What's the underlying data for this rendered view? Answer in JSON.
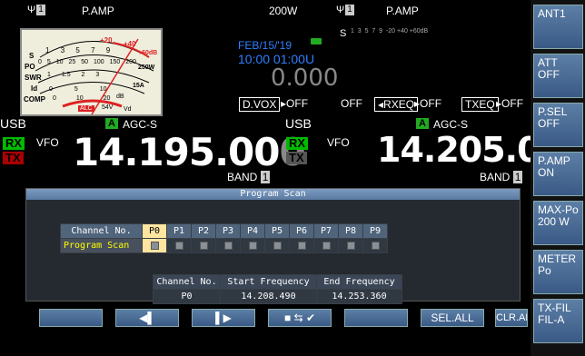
{
  "top": {
    "left_ant": "1",
    "left_mode_title": "P.AMP",
    "power": "200W",
    "right_ant": "1",
    "right_mode_title": "P.AMP",
    "date": "FEB/15/'19",
    "time": "10:00 01:00U",
    "big_value": "0.000",
    "dvox": "D.VOX",
    "dvox_state": "OFF",
    "rxeq_prefix": "OFF",
    "rxeq": "RXEQ",
    "rxeq_state": "OFF",
    "txeq": "TXEQ",
    "txeq_state": "OFF",
    "meter_scale_s": "S",
    "meter_scale_s_ticks": "1  3  5  7  9  -20 +40 +60dB"
  },
  "meter": {
    "s_label": "S",
    "po_label": "PO",
    "swr_label": "SWR",
    "id_label": "Id",
    "comp_label": "COMP",
    "alc_label": "ALC",
    "vd_label": "Vd",
    "v54_label": "54V",
    "plus20": "+20",
    "plus40": "+40",
    "plus60": "+60dB",
    "w250": "250W",
    "a15": "15A",
    "s_ticks": [
      "1",
      "3",
      "5",
      "7",
      "9"
    ],
    "po_ticks": [
      "0",
      "5",
      "10",
      "25",
      "50",
      "100",
      "150",
      "200"
    ],
    "swr_ticks": [
      "1",
      "1.5",
      "2",
      "3"
    ],
    "id_ticks": [
      "0",
      "5",
      "10"
    ],
    "comp_ticks": [
      "0",
      "10",
      "20"
    ],
    "db_label": "dB"
  },
  "vfo_a": {
    "mode": "USB",
    "agc_a": "A",
    "agc": "AGC-S",
    "rx": "RX",
    "tx": "TX",
    "label": "VFO",
    "freq_main": "14.195.00",
    "freq_last": "0",
    "band": "BAND",
    "band_num": "1"
  },
  "vfo_b": {
    "mode": "USB",
    "agc_a": "A",
    "agc": "AGC-S",
    "rx": "RX",
    "tx": "TX",
    "label": "VFO",
    "freq_main": "14.205.00",
    "freq_last": "0",
    "band": "BAND",
    "band_num": "1"
  },
  "side_buttons": [
    {
      "label": "ANT1"
    },
    {
      "label": "ATT\nOFF"
    },
    {
      "label": "P.SEL\nOFF"
    },
    {
      "label": "P.AMP\nON"
    },
    {
      "label": "MAX-Po\n200 W"
    },
    {
      "label": "METER\nPo"
    },
    {
      "label": "TX-FIL\nFIL-A"
    }
  ],
  "panel": {
    "title": "Program Scan",
    "channel_header": "Channel No.",
    "row_label": "Program Scan",
    "channels": [
      "P0",
      "P1",
      "P2",
      "P3",
      "P4",
      "P5",
      "P6",
      "P7",
      "P8",
      "P9"
    ],
    "selected_channel": "P0",
    "detail_headers": [
      "Channel No.",
      "Start Frequency",
      "End Frequency"
    ],
    "detail_values": [
      "P0",
      "14.208.490",
      "14.253.360"
    ]
  },
  "bottom_buttons": {
    "b1": "",
    "b2": "◀▌",
    "b3": "▌▶",
    "b4_icon": "■ ⇆ ✔",
    "b5": "",
    "sel_all": "SEL.ALL",
    "clr_all": "CLR.ALL"
  },
  "colors": {
    "meter_red": "#d22",
    "accent_blue": "#2f7fff",
    "cyan": "#5cf"
  }
}
